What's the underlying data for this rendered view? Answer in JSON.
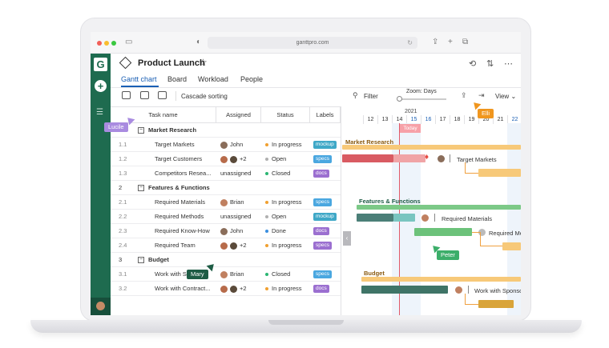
{
  "browser": {
    "url": "ganttpro.com"
  },
  "app": {
    "logo_letter": "G",
    "add_symbol": "+",
    "hamburger": "☰"
  },
  "project": {
    "title": "Product Launch"
  },
  "tabs": [
    {
      "label": "Gantt chart",
      "active": true
    },
    {
      "label": "Board"
    },
    {
      "label": "Workload"
    },
    {
      "label": "People"
    }
  ],
  "toolbar": {
    "cascade_label": "Cascade sorting",
    "filter_label": "Filter",
    "zoom_label": "Zoom: Days",
    "view_label": "View"
  },
  "grid": {
    "headers": {
      "task_name": "Task name",
      "assigned": "Assigned",
      "status": "Status",
      "labels": "Labels"
    },
    "rows": [
      {
        "num": "1",
        "group": true,
        "name": "Market Research"
      },
      {
        "num": "1.1",
        "name": "Target Markets",
        "assigned": "John",
        "avatar": "#8a6d5a",
        "status": "In progress",
        "status_color": "#f0a030",
        "tag": "mockup",
        "tag_color": "#3fa8c7"
      },
      {
        "num": "1.2",
        "name": "Target Customers",
        "assigned": "+2",
        "avatars": [
          "#b76b4a",
          "#5a4a3a"
        ],
        "status": "Open",
        "status_color": "#b0b0b0",
        "tag": "specs",
        "tag_color": "#4aa7e0"
      },
      {
        "num": "1.3",
        "name": "Competitors Resea...",
        "assigned": "unassigned",
        "status": "Closed",
        "status_color": "#2bb673",
        "tag": "docs",
        "tag_color": "#9b6fd0"
      },
      {
        "num": "2",
        "group": true,
        "name": "Features & Functions"
      },
      {
        "num": "2.1",
        "name": "Required Materials",
        "assigned": "Brian",
        "avatar": "#c08060",
        "status": "In progress",
        "status_color": "#f0a030",
        "tag": "specs",
        "tag_color": "#4aa7e0"
      },
      {
        "num": "2.2",
        "name": "Required Methods",
        "assigned": "unassigned",
        "status": "Open",
        "status_color": "#b0b0b0",
        "tag": "mockup",
        "tag_color": "#3fa8c7"
      },
      {
        "num": "2.3",
        "name": "Required Know-How",
        "assigned": "John",
        "avatar": "#8a6d5a",
        "status": "Done",
        "status_color": "#3a8fe0",
        "tag": "docs",
        "tag_color": "#9b6fd0"
      },
      {
        "num": "2.4",
        "name": "Required Team",
        "assigned": "+2",
        "avatars": [
          "#b76b4a",
          "#5a4a3a"
        ],
        "status": "In progress",
        "status_color": "#f0a030",
        "tag": "specs",
        "tag_color": "#9b6fd0"
      },
      {
        "num": "3",
        "group": true,
        "name": "Budget"
      },
      {
        "num": "3.1",
        "name": "Work with Sponsors",
        "assigned": "Brian",
        "avatar": "#c08060",
        "status": "Closed",
        "status_color": "#2bb673",
        "tag": "specs",
        "tag_color": "#4aa7e0"
      },
      {
        "num": "3.2",
        "name": "Work with Contract...",
        "assigned": "+2",
        "avatars": [
          "#b76b4a",
          "#5a4a3a"
        ],
        "status": "In progress",
        "status_color": "#f0a030",
        "tag": "docs",
        "tag_color": "#9b6fd0"
      }
    ]
  },
  "gantt": {
    "year": "2021",
    "days": [
      "12",
      "13",
      "14",
      "15",
      "16",
      "17",
      "18",
      "19",
      "20",
      "21",
      "22"
    ],
    "weekend_days": [
      "15",
      "16",
      "22"
    ],
    "today_label": "Today",
    "collapse_symbol": "‹",
    "labels": {
      "market_research": "Market Research",
      "target_markets": "Target Markets",
      "features": "Features & Functions",
      "required_materials": "Required Materials",
      "required_methods": "Required Meth",
      "budget": "Budget",
      "work_with_sponsors": "Work with Sponsors"
    }
  },
  "cursors": [
    {
      "name": "Lucile",
      "color": "#a98be0"
    },
    {
      "name": "Elli",
      "color": "#f0961e"
    },
    {
      "name": "Mary",
      "color": "#1e5c45"
    },
    {
      "name": "Peter",
      "color": "#3cae6a"
    }
  ],
  "colors": {
    "brand": "#1e6b4f",
    "accent_blue": "#1a5fb4",
    "market_bar": "#f7c979",
    "feature_bar": "#7cc987",
    "budget_bar": "#f7c979"
  },
  "icons": {
    "star": "☆",
    "history": "⟲",
    "settings": "⇅",
    "more": "⋯",
    "filter": "⚲",
    "share": "⇪",
    "export": "⇥",
    "view_caret": "⌄"
  }
}
